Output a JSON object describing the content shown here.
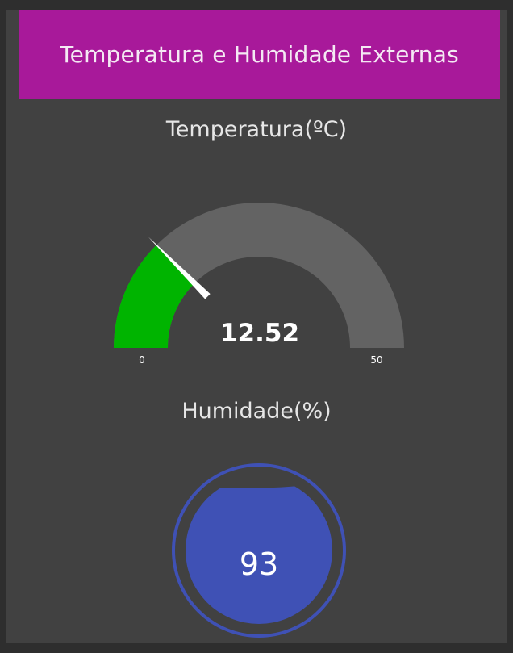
{
  "header": {
    "title": "Temperatura e Humidade Externas"
  },
  "temperature": {
    "label": "Temperatura(ºC)",
    "value": 12.52,
    "value_text": "12.52",
    "min": 0,
    "max": 50,
    "min_label": "0",
    "max_label": "50"
  },
  "humidity": {
    "label": "Humidade(%)",
    "value": 93,
    "value_text": "93"
  },
  "colors": {
    "background": "#414141",
    "header": "#a8199a",
    "gauge_track": "#636363",
    "gauge_fill": "#00b400",
    "needle": "#ffffff",
    "humidity_fill": "#3f51b5",
    "humidity_ring": "#3f51b5"
  }
}
